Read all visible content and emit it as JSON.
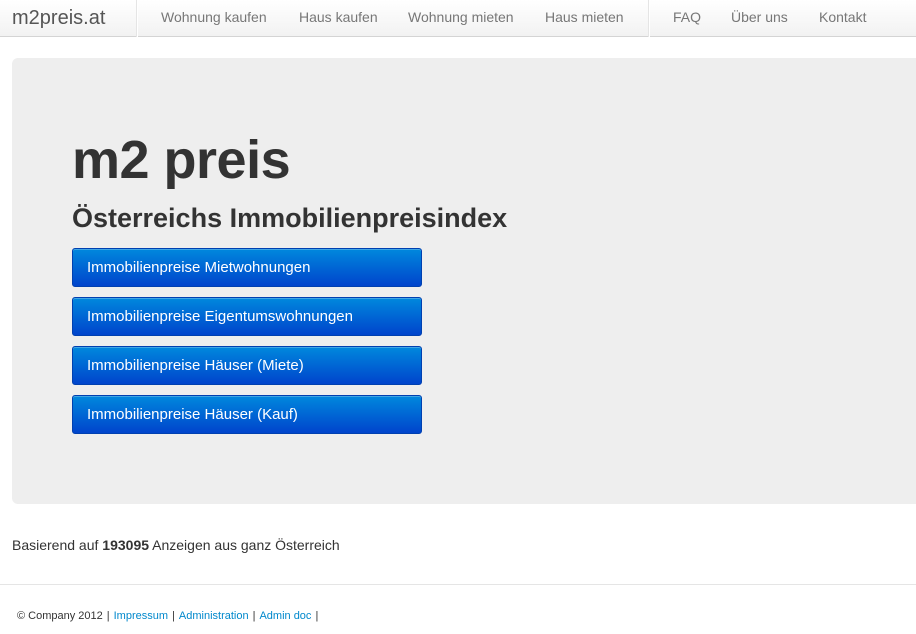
{
  "navbar": {
    "brand": "m2preis.at",
    "items": [
      {
        "label": "Wohnung kaufen"
      },
      {
        "label": "Haus kaufen"
      },
      {
        "label": "Wohnung mieten"
      },
      {
        "label": "Haus mieten"
      },
      {
        "label": "FAQ"
      },
      {
        "label": "Über uns"
      },
      {
        "label": "Kontakt"
      }
    ]
  },
  "hero": {
    "title": "m2 preis",
    "subtitle": "Österreichs Immobilienpreisindex",
    "buttons": [
      {
        "label": "Immobilienpreise Mietwohnungen"
      },
      {
        "label": "Immobilienpreise Eigentumswohnungen"
      },
      {
        "label": "Immobilienpreise Häuser (Miete)"
      },
      {
        "label": "Immobilienpreise Häuser (Kauf)"
      }
    ]
  },
  "stats": {
    "prefix": "Basierend auf",
    "count": "193095",
    "suffix": "Anzeigen aus ganz Österreich"
  },
  "footer": {
    "copyright": "© Company 2012",
    "separator": "|",
    "links": [
      {
        "label": "Impressum"
      },
      {
        "label": "Administration"
      },
      {
        "label": "Admin doc"
      }
    ]
  },
  "colors": {
    "button_top": "#0088dd",
    "button_bottom": "#0044cc",
    "hero_background": "#eeeeee",
    "link": "#0088cc"
  }
}
